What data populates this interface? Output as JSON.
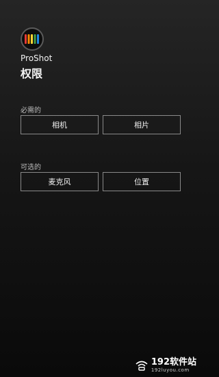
{
  "app": {
    "name": "ProShot",
    "logo_icon": "proshot-logo-icon",
    "logo_colors": [
      "#e53935",
      "#fb8c00",
      "#fdd835",
      "#43a047",
      "#1e88e5"
    ]
  },
  "page": {
    "title": "权限"
  },
  "sections": {
    "required": {
      "label": "必需的",
      "buttons": [
        "相机",
        "相片"
      ]
    },
    "optional": {
      "label": "可选的",
      "buttons": [
        "麦克风",
        "位置"
      ]
    }
  },
  "watermark": {
    "icon": "wifi-icon",
    "main": "192软件站",
    "sub": "192luyou.com"
  }
}
